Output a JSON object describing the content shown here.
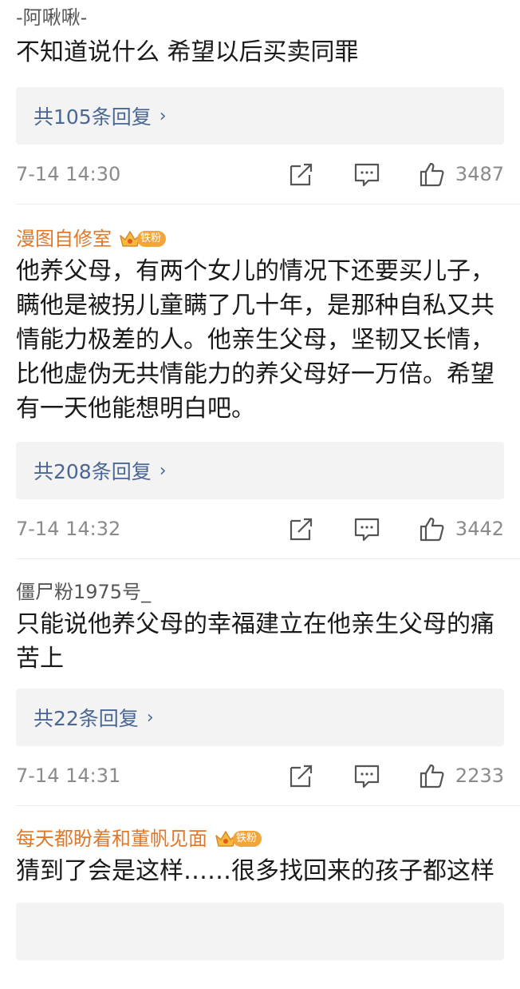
{
  "comments": [
    {
      "username": "-阿啾啾-",
      "text": "不知道说什么 希望以后买卖同罪",
      "reply_label": "共105条回复",
      "time": "7-14 14:30",
      "likes": "3487"
    },
    {
      "username": "漫图自修室",
      "badge": "铁粉",
      "text": "他养父母，有两个女儿的情况下还要买儿子，瞒他是被拐儿童瞒了几十年，是那种自私又共情能力极差的人。他亲生父母，坚韧又长情，比他虚伪无共情能力的养父母好一万倍。希望有一天他能想明白吧。",
      "reply_label": "共208条回复",
      "time": "7-14 14:32",
      "likes": "3442"
    },
    {
      "username": "僵尸粉1975号_",
      "text": "只能说他养父母的幸福建立在他亲生父母的痛苦上",
      "reply_label": "共22条回复",
      "time": "7-14 14:31",
      "likes": "2233"
    },
    {
      "username": "每天都盼着和董帆见面",
      "badge": "铁粉",
      "text": "猜到了会是这样……很多找回来的孩子都这样"
    }
  ],
  "icons": {
    "share": "share-icon",
    "comment": "comment-icon",
    "like": "thumbs-up-icon",
    "crown": "crown-icon",
    "chevron": "chevron-right-icon"
  },
  "colors": {
    "link": "#4a6794",
    "vip_name": "#e0782b",
    "badge": "#f2a53a"
  },
  "ui": {
    "chevron": "›"
  }
}
